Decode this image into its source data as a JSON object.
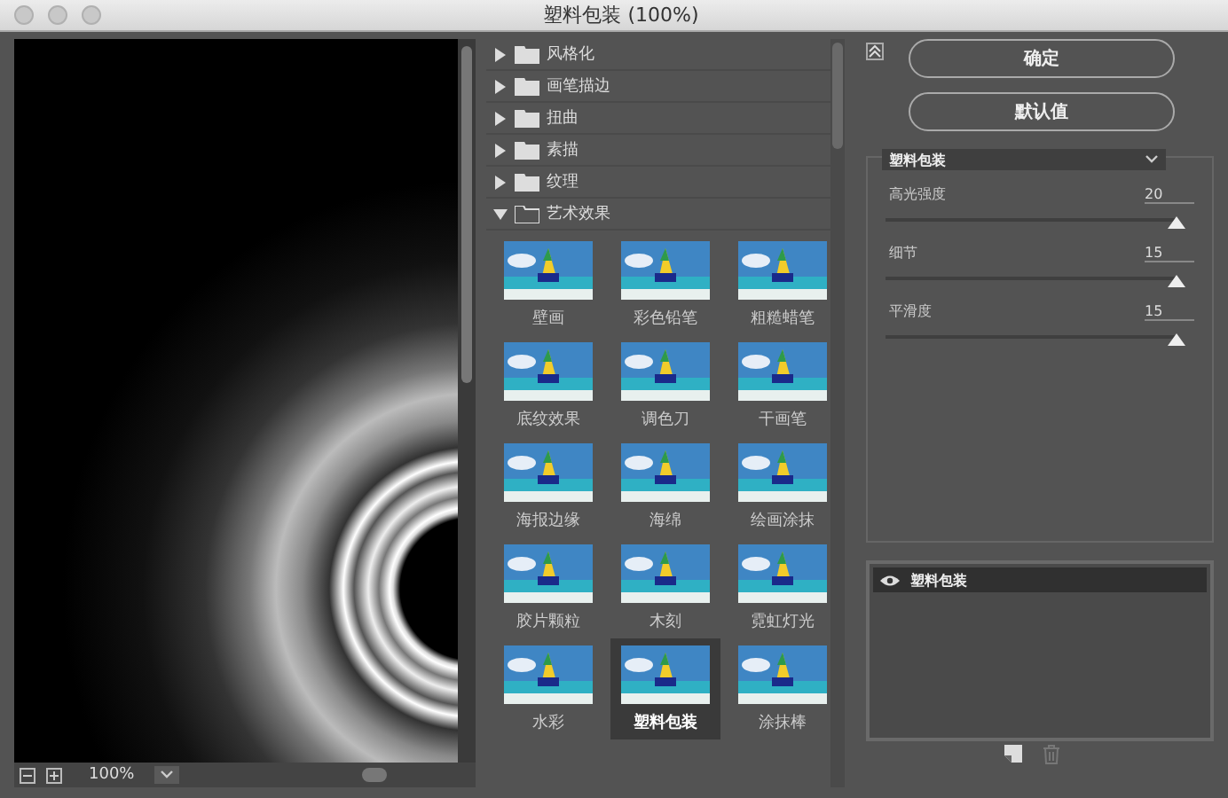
{
  "window": {
    "title": "塑料包装 (100%)"
  },
  "preview": {
    "zoom": "100%"
  },
  "categories": [
    {
      "label": "风格化",
      "expanded": false
    },
    {
      "label": "画笔描边",
      "expanded": false
    },
    {
      "label": "扭曲",
      "expanded": false
    },
    {
      "label": "素描",
      "expanded": false
    },
    {
      "label": "纹理",
      "expanded": false
    },
    {
      "label": "艺术效果",
      "expanded": true,
      "filters": [
        {
          "label": "壁画",
          "selected": false
        },
        {
          "label": "彩色铅笔",
          "selected": false
        },
        {
          "label": "粗糙蜡笔",
          "selected": false
        },
        {
          "label": "底纹效果",
          "selected": false
        },
        {
          "label": "调色刀",
          "selected": false
        },
        {
          "label": "干画笔",
          "selected": false
        },
        {
          "label": "海报边缘",
          "selected": false
        },
        {
          "label": "海绵",
          "selected": false
        },
        {
          "label": "绘画涂抹",
          "selected": false
        },
        {
          "label": "胶片颗粒",
          "selected": false
        },
        {
          "label": "木刻",
          "selected": false
        },
        {
          "label": "霓虹灯光",
          "selected": false
        },
        {
          "label": "水彩",
          "selected": false
        },
        {
          "label": "塑料包装",
          "selected": true
        },
        {
          "label": "涂抹棒",
          "selected": false
        }
      ]
    }
  ],
  "buttons": [
    "确定",
    "默认值"
  ],
  "settings": {
    "filter": "塑料包装",
    "params": [
      {
        "label": "高光强度",
        "value": "20",
        "level": 1
      },
      {
        "label": "细节",
        "value": "15",
        "level": 1
      },
      {
        "label": "平滑度",
        "value": "15",
        "level": 1
      }
    ]
  },
  "layers": [
    {
      "name": "塑料包装",
      "visible": true,
      "selected": true
    }
  ]
}
